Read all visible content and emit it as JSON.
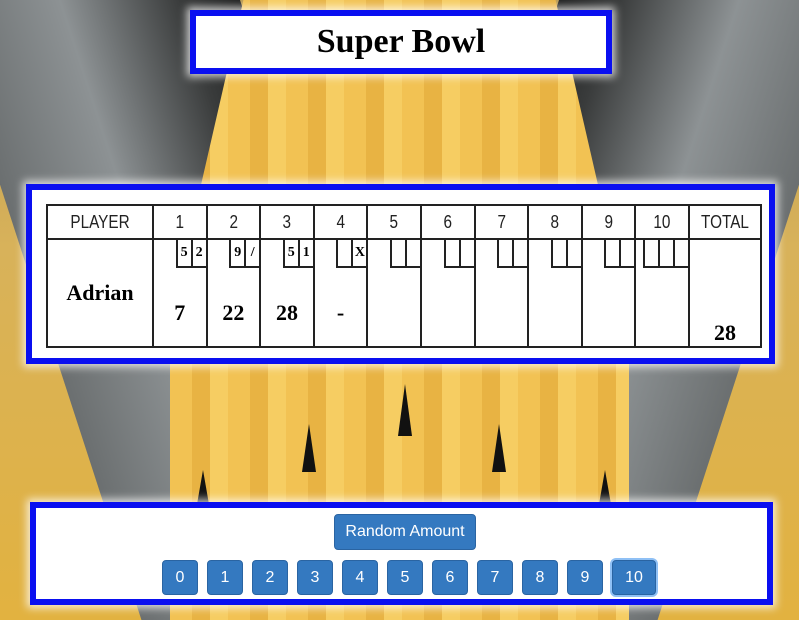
{
  "title": "Super Bowl",
  "scoresheet": {
    "headers": [
      "PLAYER",
      "1",
      "2",
      "3",
      "4",
      "5",
      "6",
      "7",
      "8",
      "9",
      "10",
      "TOTAL"
    ],
    "player": "Adrian",
    "frames": [
      {
        "r1": "5",
        "r2": "2",
        "score": "7"
      },
      {
        "r1": "9",
        "r2": "/",
        "score": "22"
      },
      {
        "r1": "5",
        "r2": "1",
        "score": "28"
      },
      {
        "r1": "",
        "r2": "X",
        "score": "-"
      },
      {
        "r1": "",
        "r2": "",
        "score": ""
      },
      {
        "r1": "",
        "r2": "",
        "score": ""
      },
      {
        "r1": "",
        "r2": "",
        "score": ""
      },
      {
        "r1": "",
        "r2": "",
        "score": ""
      },
      {
        "r1": "",
        "r2": "",
        "score": ""
      },
      {
        "r1": "",
        "r2": "",
        "r3": "",
        "score": ""
      }
    ],
    "total": "28"
  },
  "controls": {
    "random_label": "Random Amount",
    "pin_buttons": [
      "0",
      "1",
      "2",
      "3",
      "4",
      "5",
      "6",
      "7",
      "8",
      "9",
      "10"
    ]
  }
}
